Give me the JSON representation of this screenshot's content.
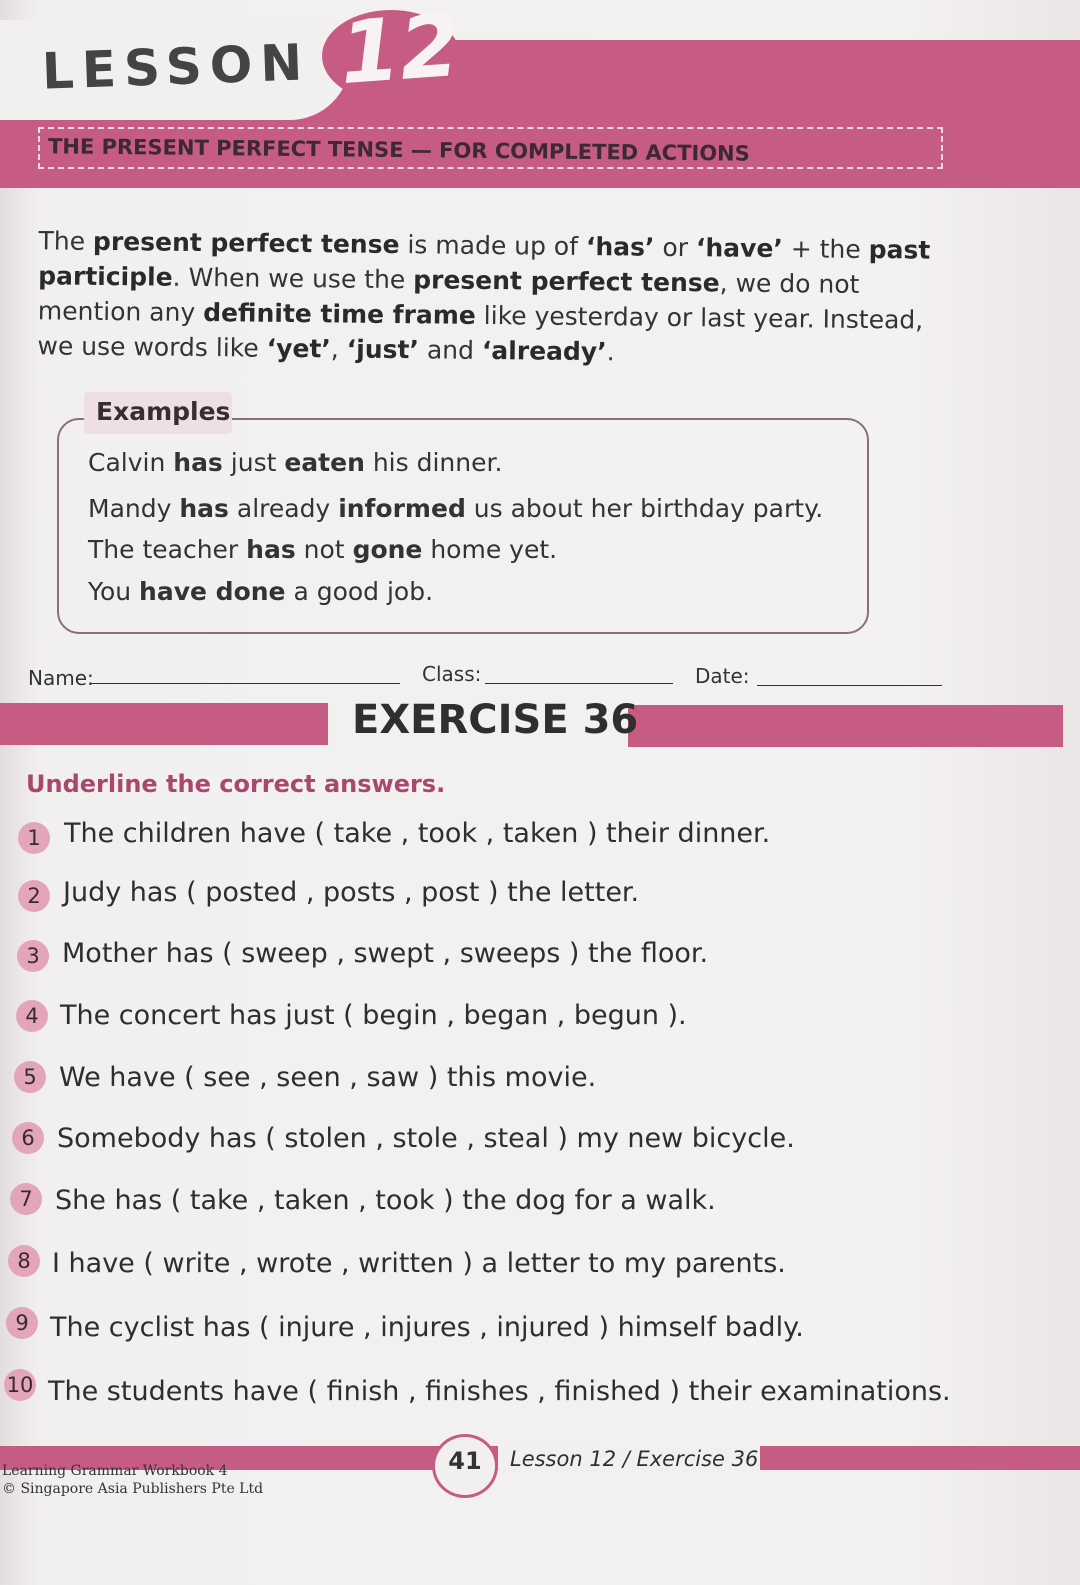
{
  "header": {
    "lesson_word": "LESSON",
    "lesson_number": "12",
    "topic": "THE PRESENT PERFECT TENSE — FOR COMPLETED ACTIONS"
  },
  "intro": {
    "p1": "The ",
    "b1": "present perfect tense",
    "p2": " is made up of ",
    "b2": "‘has’",
    "p3": " or ",
    "b3": "‘have’",
    "p4": " + the ",
    "b4": "past participle",
    "p5": ". When we use the ",
    "b5": "present perfect tense",
    "p6": ", we do not mention any ",
    "b6": "definite time frame",
    "p7": " like yesterday or last year. Instead, we use words like ",
    "b7": "‘yet’",
    "p8": ", ",
    "b8": "‘just’",
    "p9": " and ",
    "b9": "‘already’",
    "p10": "."
  },
  "examples": {
    "label": "Examples",
    "e1": {
      "a": "Calvin ",
      "b": "has",
      "c": " just ",
      "d": "eaten",
      "e": " his dinner."
    },
    "e2": {
      "a": "Mandy ",
      "b": "has",
      "c": " already ",
      "d": "informed",
      "e": " us about her birthday party."
    },
    "e3": {
      "a": "The teacher ",
      "b": "has",
      "c": " not ",
      "d": "gone",
      "e": " home yet."
    },
    "e4": {
      "a": "You ",
      "b": "have done",
      "c": " a good job."
    }
  },
  "meta": {
    "name_label": "Name:",
    "class_label": "Class:",
    "date_label": "Date:"
  },
  "exercise": {
    "title": "EXERCISE 36",
    "instruction": "Underline the correct answers.",
    "questions": [
      {
        "num": "1",
        "text": "The children have ( take , took , taken ) their dinner."
      },
      {
        "num": "2",
        "text": "Judy has ( posted , posts , post ) the letter."
      },
      {
        "num": "3",
        "text": "Mother has ( sweep , swept , sweeps ) the floor."
      },
      {
        "num": "4",
        "text": "The concert has just ( begin , began , begun )."
      },
      {
        "num": "5",
        "text": "We have ( see , seen , saw ) this movie."
      },
      {
        "num": "6",
        "text": "Somebody has ( stolen , stole , steal ) my new bicycle."
      },
      {
        "num": "7",
        "text": "She has ( take , taken , took ) the dog for a walk."
      },
      {
        "num": "8",
        "text": "I have ( write , wrote , written ) a letter to my parents."
      },
      {
        "num": "9",
        "text": "The cyclist has ( injure , injures , injured ) himself badly."
      },
      {
        "num": "10",
        "text": "The students have ( finish , finishes , finished ) their examinations."
      }
    ]
  },
  "footer": {
    "page_number": "41",
    "label": "Lesson 12 / Exercise 36",
    "book": "Learning Grammar Workbook 4",
    "copyright": "© Singapore Asia Publishers Pte Ltd"
  },
  "colors": {
    "accent": "#c65b84",
    "instruction": "#a8486e"
  }
}
